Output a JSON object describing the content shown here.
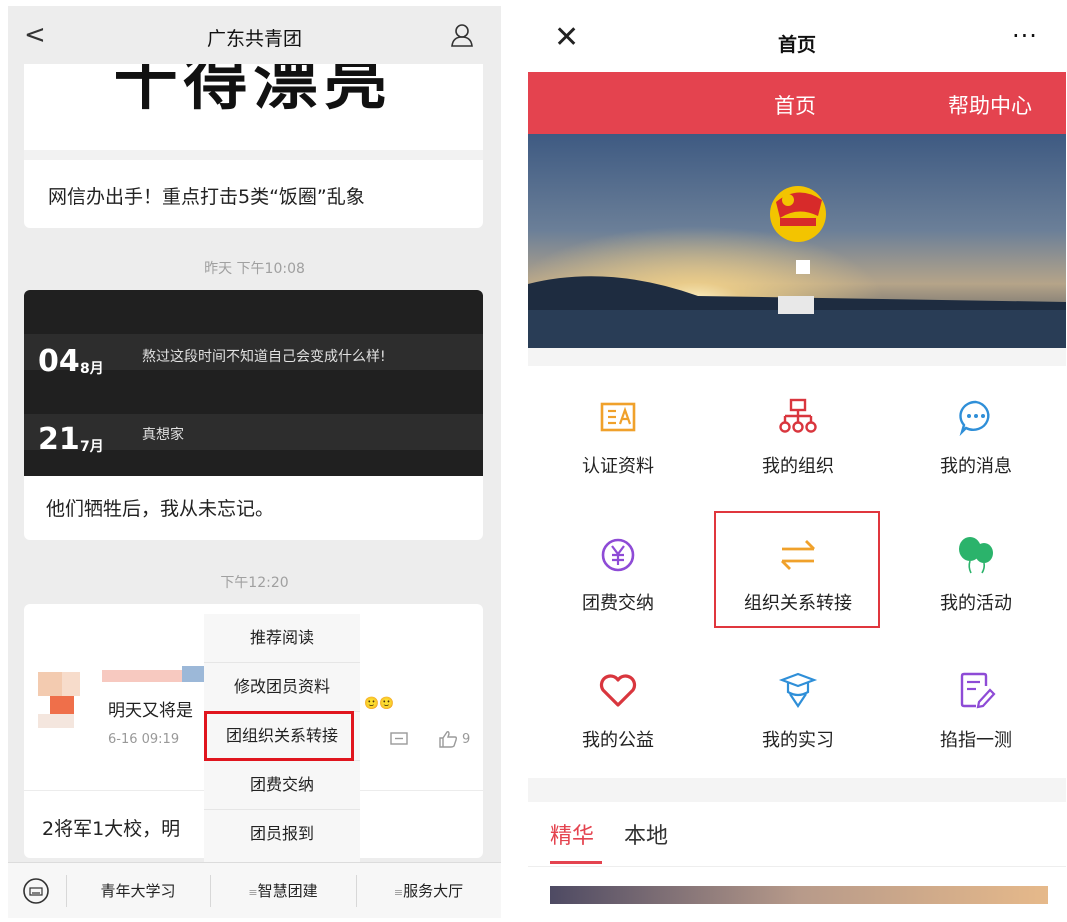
{
  "left": {
    "nav": {
      "title": "广东共青团",
      "back_glyph": "<"
    },
    "headline_partial": "十得漂亮",
    "news1": "网信办出手！重点打击5类“饭圈”乱象",
    "time1": "昨天 下午10:08",
    "dark_card": {
      "day1": "04",
      "month1": "8月",
      "text1": "熬过这段时间不知道自己会变成什么样!",
      "day2": "21",
      "month2": "7月",
      "text2": "真想家"
    },
    "news2": "他们牺牲后，我从未忘记。",
    "time2": "下午12:20",
    "post": {
      "text": "明天又将是",
      "time": "6-16 09:19",
      "likes": "9"
    },
    "news3": "2将军1大校，明",
    "menu": [
      "推荐阅读",
      "修改团员资料",
      "团组织关系转接",
      "团费交纳",
      "团员报到"
    ],
    "tabbar": [
      "青年大学习",
      "智慧团建",
      "服务大厅"
    ]
  },
  "right": {
    "nav": {
      "close_glyph": "✕",
      "title": "首页",
      "more_glyph": "···"
    },
    "redbar": {
      "home": "首页",
      "help": "帮助中心"
    },
    "grid": [
      {
        "label": "认证资料",
        "icon": "id-card-icon",
        "color": "#f0a12b"
      },
      {
        "label": "我的组织",
        "icon": "org-chart-icon",
        "color": "#d9363e"
      },
      {
        "label": "我的消息",
        "icon": "chat-bubble-icon",
        "color": "#2f8fd8"
      },
      {
        "label": "团费交纳",
        "icon": "yuan-coin-icon",
        "color": "#8e4bd6"
      },
      {
        "label": "组织关系转接",
        "icon": "transfer-arrows-icon",
        "color": "#f0a12b"
      },
      {
        "label": "我的活动",
        "icon": "balloons-icon",
        "color": "#2bb36b"
      },
      {
        "label": "我的公益",
        "icon": "heart-icon",
        "color": "#d9363e"
      },
      {
        "label": "我的实习",
        "icon": "graduation-cap-icon",
        "color": "#2f8fd8"
      },
      {
        "label": "掐指一测",
        "icon": "edit-note-icon",
        "color": "#8e4bd6"
      }
    ],
    "tabs": [
      "精华",
      "本地"
    ],
    "colors": {
      "accent_red": "#e4434f",
      "highlight_border": "#e0363d"
    }
  }
}
